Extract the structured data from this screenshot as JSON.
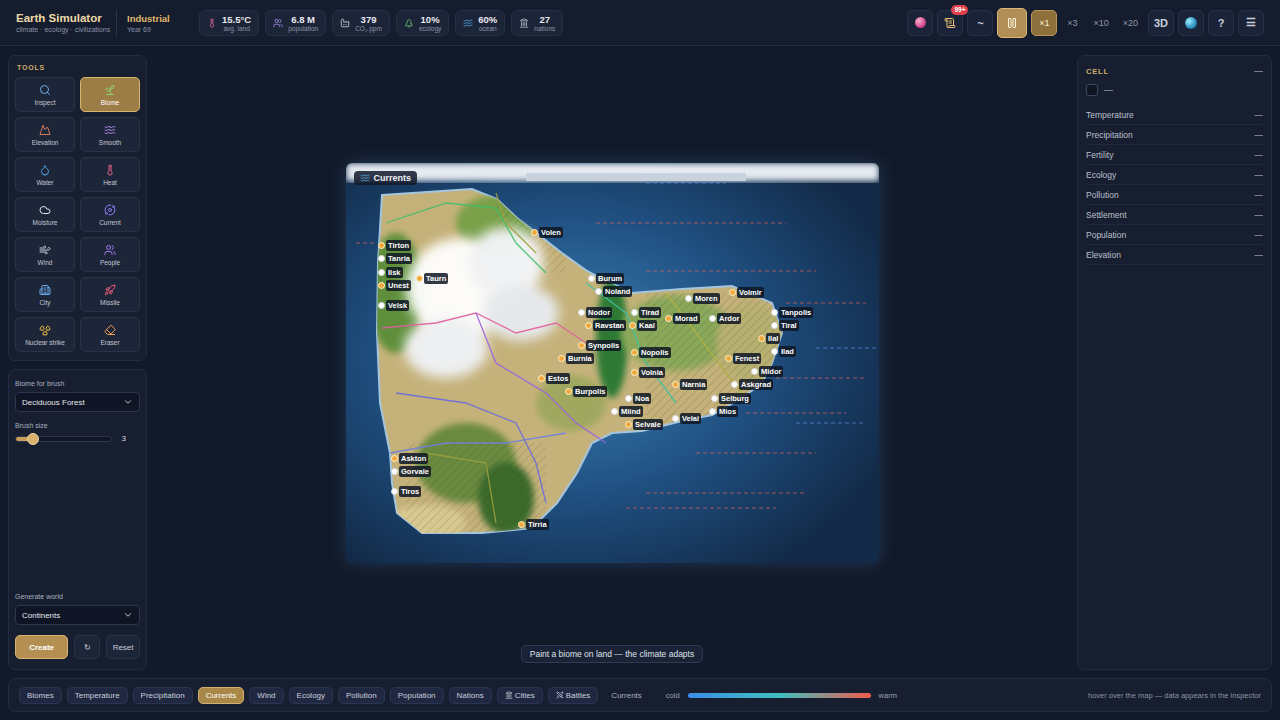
{
  "app": {
    "title": "Earth Simulator",
    "subtitle": "climate · ecology · civilizations"
  },
  "era": {
    "name": "Industrial",
    "year": "Year 69"
  },
  "stats": [
    {
      "value": "15.5°C",
      "label": "avg. land"
    },
    {
      "value": "6.8 M",
      "label": "population"
    },
    {
      "value": "379",
      "label": "CO₂ ppm"
    },
    {
      "value": "10%",
      "label": "ecology"
    },
    {
      "value": "60%",
      "label": "ocean"
    },
    {
      "value": "27",
      "label": "nations"
    }
  ],
  "controls": {
    "events_badge": "99+",
    "trend": "~",
    "pause_active": true,
    "speeds": [
      {
        "label": "×1",
        "selected": true
      },
      {
        "label": "×3",
        "selected": false
      },
      {
        "label": "×10",
        "selected": false
      },
      {
        "label": "×20",
        "selected": false
      }
    ],
    "view": "3D",
    "help": "?",
    "menu": "☰"
  },
  "tools": {
    "title": "TOOLS",
    "items": [
      {
        "label": "Inspect",
        "selected": false
      },
      {
        "label": "Biome",
        "selected": true
      },
      {
        "label": "Elevation",
        "selected": false
      },
      {
        "label": "Smooth",
        "selected": false
      },
      {
        "label": "Water",
        "selected": false
      },
      {
        "label": "Heat",
        "selected": false
      },
      {
        "label": "Moisture",
        "selected": false
      },
      {
        "label": "Current",
        "selected": false
      },
      {
        "label": "Wind",
        "selected": false
      },
      {
        "label": "People",
        "selected": false
      },
      {
        "label": "City",
        "selected": false
      },
      {
        "label": "Missile",
        "selected": false
      },
      {
        "label": "Nuclear strike",
        "selected": false
      },
      {
        "label": "Eraser",
        "selected": false
      }
    ]
  },
  "brush": {
    "biome_label": "Biome for brush",
    "biome": "Deciduous Forest",
    "size_label": "Brush size",
    "size": "3",
    "level": 0.18
  },
  "generate": {
    "label": "Generate world",
    "preset": "Continents",
    "create": "Create",
    "reroll": "↻",
    "reset": "Reset"
  },
  "map": {
    "layer_title": "Currents",
    "cities": [
      {
        "name": "Tirton",
        "capital": true
      },
      {
        "name": "Tanria",
        "capital": false
      },
      {
        "name": "Ilsk",
        "capital": false
      },
      {
        "name": "Unest",
        "capital": true
      },
      {
        "name": "Velsk",
        "capital": false
      },
      {
        "name": "Taurn",
        "capital": true
      },
      {
        "name": "Volen",
        "capital": true
      },
      {
        "name": "Burum",
        "capital": false
      },
      {
        "name": "Noland",
        "capital": false
      },
      {
        "name": "Nodor",
        "capital": false
      },
      {
        "name": "Tirad",
        "capital": false
      },
      {
        "name": "Ravstan",
        "capital": true
      },
      {
        "name": "Kaal",
        "capital": true
      },
      {
        "name": "Morad",
        "capital": true
      },
      {
        "name": "Moren",
        "capital": false
      },
      {
        "name": "Volmir",
        "capital": true
      },
      {
        "name": "Ardor",
        "capital": false
      },
      {
        "name": "Tanpolis",
        "capital": false
      },
      {
        "name": "Tiral",
        "capital": false
      },
      {
        "name": "Ilal",
        "capital": true
      },
      {
        "name": "Ilad",
        "capital": false
      },
      {
        "name": "Synpolis",
        "capital": true
      },
      {
        "name": "Nopolis",
        "capital": true
      },
      {
        "name": "Burnia",
        "capital": true
      },
      {
        "name": "Fenest",
        "capital": true
      },
      {
        "name": "Midor",
        "capital": false
      },
      {
        "name": "Volnia",
        "capital": true
      },
      {
        "name": "Narnia",
        "capital": true
      },
      {
        "name": "Estos",
        "capital": true
      },
      {
        "name": "Askgrad",
        "capital": false
      },
      {
        "name": "Burpolis",
        "capital": true
      },
      {
        "name": "Selburg",
        "capital": false
      },
      {
        "name": "Noa",
        "capital": false
      },
      {
        "name": "Miind",
        "capital": false
      },
      {
        "name": "Mios",
        "capital": false
      },
      {
        "name": "Velai",
        "capital": false
      },
      {
        "name": "Selvale",
        "capital": true
      },
      {
        "name": "Askton",
        "capital": true
      },
      {
        "name": "Gorvale",
        "capital": false
      },
      {
        "name": "Tiros",
        "capital": false
      },
      {
        "name": "Tirria",
        "capital": true
      }
    ]
  },
  "hint": "Paint a biome on land — the climate adapts",
  "inspector": {
    "title": "CELL",
    "collapse": "—",
    "cell_value": "—",
    "rows": [
      {
        "label": "Temperature",
        "value": "—"
      },
      {
        "label": "Precipitation",
        "value": "—"
      },
      {
        "label": "Fertility",
        "value": "—"
      },
      {
        "label": "Ecology",
        "value": "—"
      },
      {
        "label": "Pollution",
        "value": "—"
      },
      {
        "label": "Settlement",
        "value": "—"
      },
      {
        "label": "Population",
        "value": "—"
      },
      {
        "label": "Elevation",
        "value": "—"
      }
    ]
  },
  "layers": [
    {
      "label": "Biomes",
      "selected": false,
      "kind": "plain"
    },
    {
      "label": "Temperature",
      "selected": false,
      "kind": "plain"
    },
    {
      "label": "Precipitation",
      "selected": false,
      "kind": "plain"
    },
    {
      "label": "Currents",
      "selected": true,
      "kind": "plain"
    },
    {
      "label": "Wind",
      "selected": false,
      "kind": "plain"
    },
    {
      "label": "Ecology",
      "selected": false,
      "kind": "plain"
    },
    {
      "label": "Pollution",
      "selected": false,
      "kind": "plain"
    },
    {
      "label": "Population",
      "selected": false,
      "kind": "plain"
    },
    {
      "label": "Nations",
      "selected": false,
      "kind": "plain"
    },
    {
      "label": "Cities",
      "selected": false,
      "kind": "cities"
    },
    {
      "label": "Battles",
      "selected": false,
      "kind": "battles"
    }
  ],
  "legend": {
    "title": "Currents",
    "low": "cold",
    "high": "warm"
  },
  "status": "hover over the map — data appears in the inspector"
}
